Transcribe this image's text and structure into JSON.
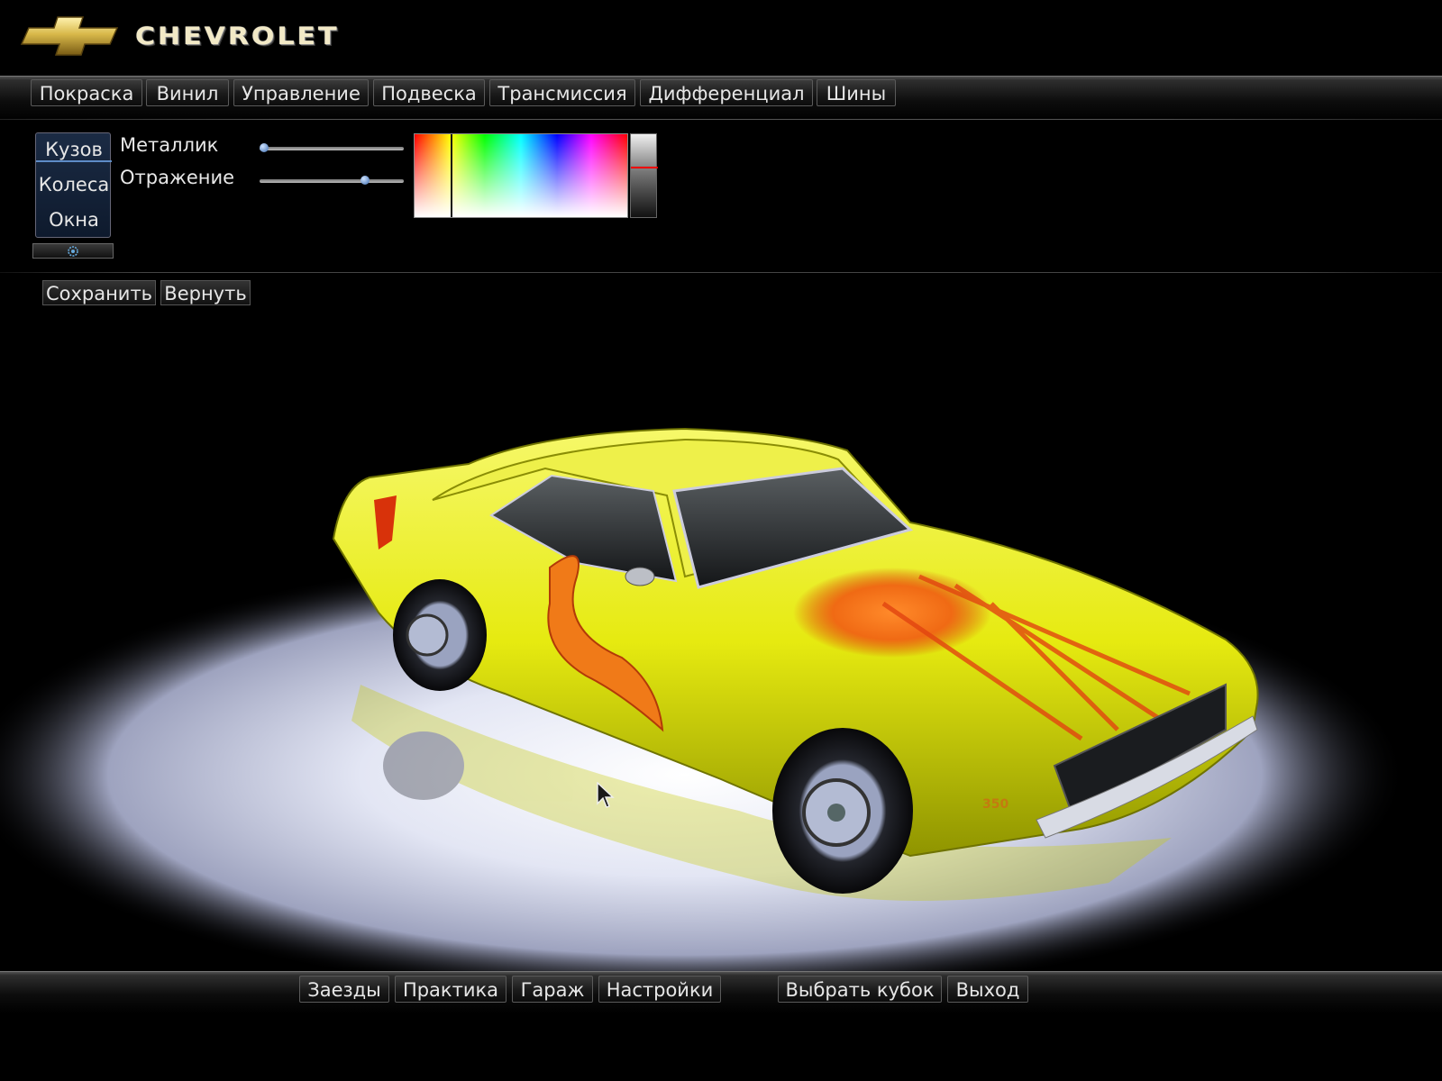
{
  "brand": {
    "name": "CHEVROLET",
    "logo_icon": "chevrolet-bowtie-icon",
    "logo_color": "#d8b84a"
  },
  "top_tabs": [
    {
      "label": "Покраска",
      "active": true
    },
    {
      "label": "Винил",
      "active": false
    },
    {
      "label": "Управление",
      "active": false
    },
    {
      "label": "Подвеска",
      "active": false
    },
    {
      "label": "Трансмиссия",
      "active": false
    },
    {
      "label": "Дифференциал",
      "active": false
    },
    {
      "label": "Шины",
      "active": false
    }
  ],
  "paint": {
    "parts": [
      {
        "label": "Кузов",
        "selected": true
      },
      {
        "label": "Колеса",
        "selected": false
      },
      {
        "label": "Окна",
        "selected": false
      }
    ],
    "extra_button_icon": "gear-icon",
    "metallic": {
      "label": "Металлик",
      "value": 0.03
    },
    "reflection": {
      "label": "Отражение",
      "value": 0.73
    },
    "hue_position": 0.17,
    "brightness_position": 0.39,
    "selected_color": "#f2f200"
  },
  "actions": {
    "save_label": "Сохранить",
    "revert_label": "Вернуть"
  },
  "car": {
    "body_color": "#e6ea10",
    "badge": "350"
  },
  "bottom_tabs": [
    {
      "label": "Заезды",
      "active": false
    },
    {
      "label": "Практика",
      "active": false
    },
    {
      "label": "Гараж",
      "active": true
    },
    {
      "label": "Настройки",
      "active": false
    },
    {
      "label": "Выбрать кубок",
      "active": false
    },
    {
      "label": "Выход",
      "active": false
    }
  ]
}
